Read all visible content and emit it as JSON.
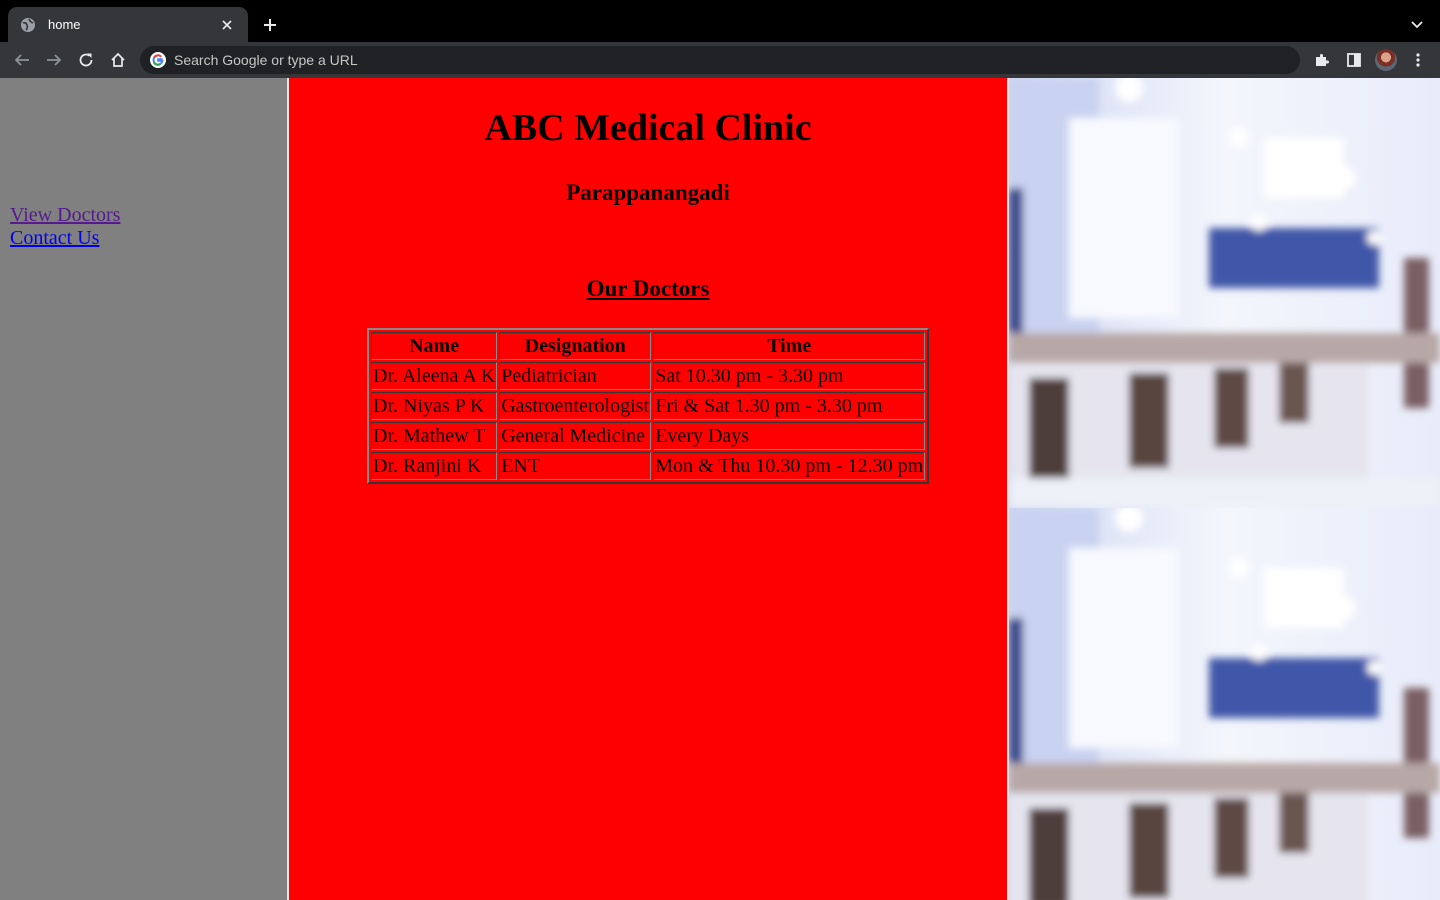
{
  "browser": {
    "tab_title": "home",
    "omnibox_placeholder": "Search Google or type a URL"
  },
  "sidebar": {
    "links": [
      {
        "label": "View Doctors",
        "state": "visited"
      },
      {
        "label": "Contact Us",
        "state": "unvisited"
      }
    ]
  },
  "main": {
    "title": "ABC Medical Clinic",
    "subtitle": "Parappanangadi",
    "section_heading": "Our Doctors",
    "table": {
      "headers": [
        "Name",
        "Designation",
        "Time"
      ],
      "rows": [
        [
          "Dr. Aleena A K",
          "Pediatrician",
          "Sat 10.30 pm - 3.30 pm"
        ],
        [
          "Dr. Niyas P K",
          "Gastroenterologist",
          "Fri & Sat 1.30 pm - 3.30 pm"
        ],
        [
          "Dr. Mathew T",
          "General Medicine",
          "Every Days"
        ],
        [
          "Dr. Ranjini K",
          "ENT",
          "Mon & Thu 10.30 pm - 12.30 pm"
        ]
      ]
    }
  },
  "colors": {
    "left_frame_bg": "#808080",
    "center_frame_bg": "#ff0000",
    "visited_link": "#551a8b",
    "unvisited_link": "#0000ee"
  }
}
